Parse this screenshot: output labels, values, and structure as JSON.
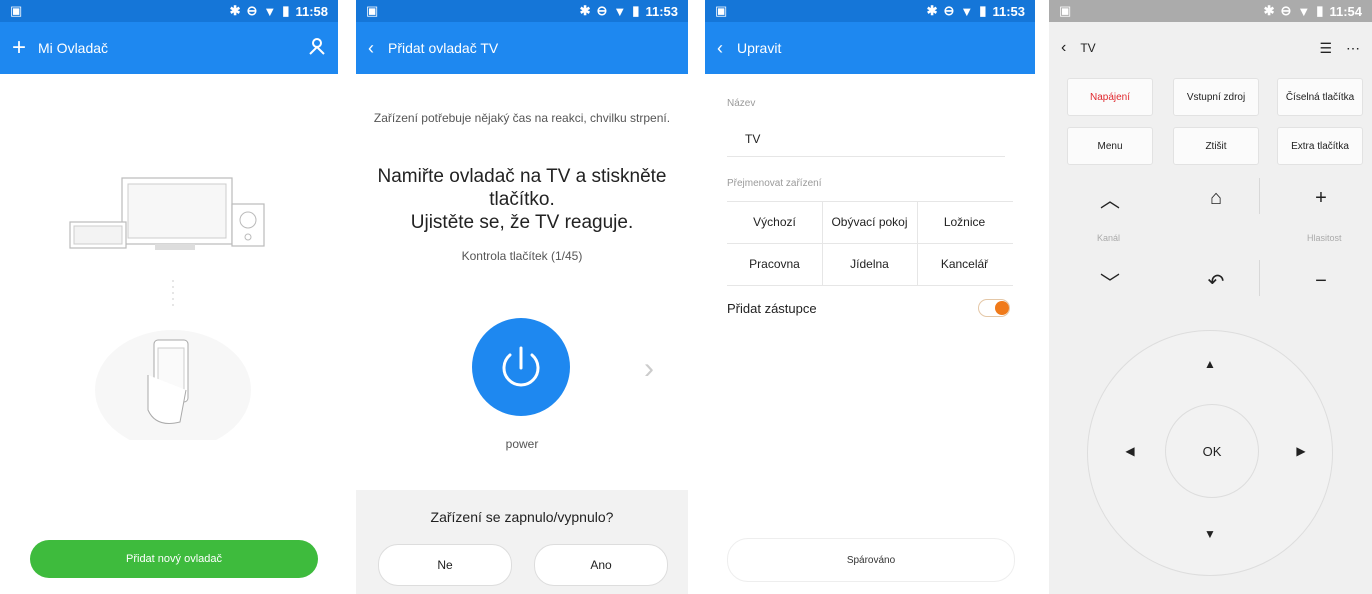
{
  "status_times": [
    "11:58",
    "11:53",
    "11:53",
    "11:54"
  ],
  "colors": {
    "accent": "#1e88f0",
    "green": "#3ebb3d",
    "orange": "#f07a1a",
    "red": "#e0282e"
  },
  "screen1": {
    "title": "Mi Ovladač",
    "add_remote_button": "Přidat nový ovladač"
  },
  "screen2": {
    "title": "Přidat ovladač TV",
    "hint": "Zařízení potřebuje nějaký čas na reakci, chvilku strpení.",
    "instruction_line1": "Namiřte ovladač na TV a stiskněte",
    "instruction_line2": "tlačítko.",
    "instruction_line3": "Ujistěte se, že TV reaguje.",
    "check_progress": "Kontrola tlačítek (1/45)",
    "power_label": "power",
    "question": "Zařízení se zapnulo/vypnulo?",
    "no_button": "Ne",
    "yes_button": "Ano"
  },
  "screen3": {
    "title": "Upravit",
    "name_label": "Název",
    "name_value": "TV",
    "rename_label": "Přejmenovat zařízení",
    "rooms": [
      "Výchozí",
      "Obývací pokoj",
      "Ložnice",
      "Pracovna",
      "Jídelna",
      "Kancelář"
    ],
    "shortcut_label": "Přidat zástupce",
    "shortcut_enabled": true,
    "paired_button": "Spárováno"
  },
  "screen4": {
    "title": "TV",
    "buttons_row1": [
      "Napájení",
      "Vstupní zdroj",
      "Číselná tlačítka"
    ],
    "buttons_row2": [
      "Menu",
      "Ztišit",
      "Extra tlačítka"
    ],
    "channel_label": "Kanál",
    "volume_label": "Hlasitost",
    "ok_label": "OK"
  }
}
